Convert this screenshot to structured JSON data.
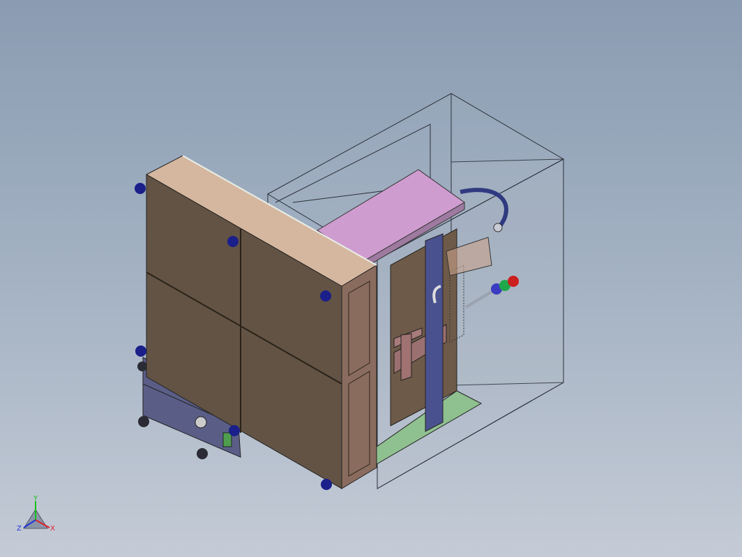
{
  "viewport": {
    "background_top": "#8a9cb2",
    "background_bottom": "#c4cbd6"
  },
  "model": {
    "panel_color": "#625345",
    "frame_color": "#d5b7a0",
    "top_plate_color": "#cf9ccf",
    "base_color": "#8fc08f",
    "column_color": "#4a518f",
    "leveling_foot_color": "#1a1f8a",
    "cart_color": "#5a5e87",
    "enclosure_color": "#b3bdca"
  },
  "signal_tower": {
    "lights": [
      "#cc1f1f",
      "#1fa84a",
      "#3c3cc0"
    ]
  },
  "triad": {
    "y_label": "Y",
    "x_label": "X",
    "z_label": "Z",
    "x_color": "#e0202a",
    "y_color": "#16c01a",
    "z_color": "#2036d6"
  }
}
